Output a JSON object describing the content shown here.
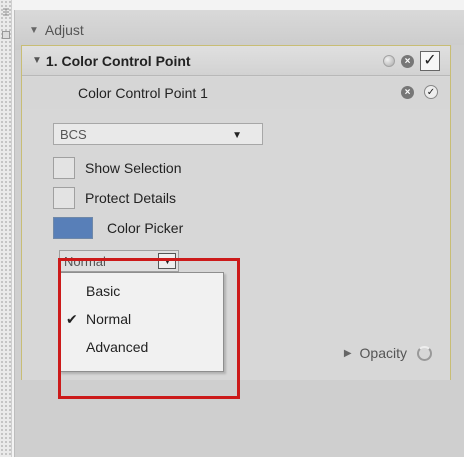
{
  "adjust": {
    "title": "Adjust"
  },
  "ccp": {
    "header_title": "1. Color Control Point",
    "checked": true,
    "item_label": "Color Control Point 1",
    "method_select": "BCS",
    "options": {
      "show_selection": "Show Selection",
      "protect_details": "Protect Details",
      "color_picker": "Color Picker"
    },
    "color_swatch": "#587fb8",
    "mode": {
      "selected": "Normal",
      "menu": [
        "Basic",
        "Normal",
        "Advanced"
      ],
      "checked_index": 1
    },
    "opacity_label": "Opacity"
  },
  "icons": {
    "adjust_toggle": "triangle-down-icon",
    "ccp_toggle": "triangle-down-icon",
    "dot": "dot-icon",
    "close": "close-circle-icon",
    "check": "check-icon",
    "dropdown": "chevron-down-icon",
    "opacity_expand": "triangle-right-icon",
    "opacity_ring": "ring-icon"
  },
  "colors": {
    "highlight": "#cc1a1a",
    "panel_border": "#c8bd74"
  }
}
